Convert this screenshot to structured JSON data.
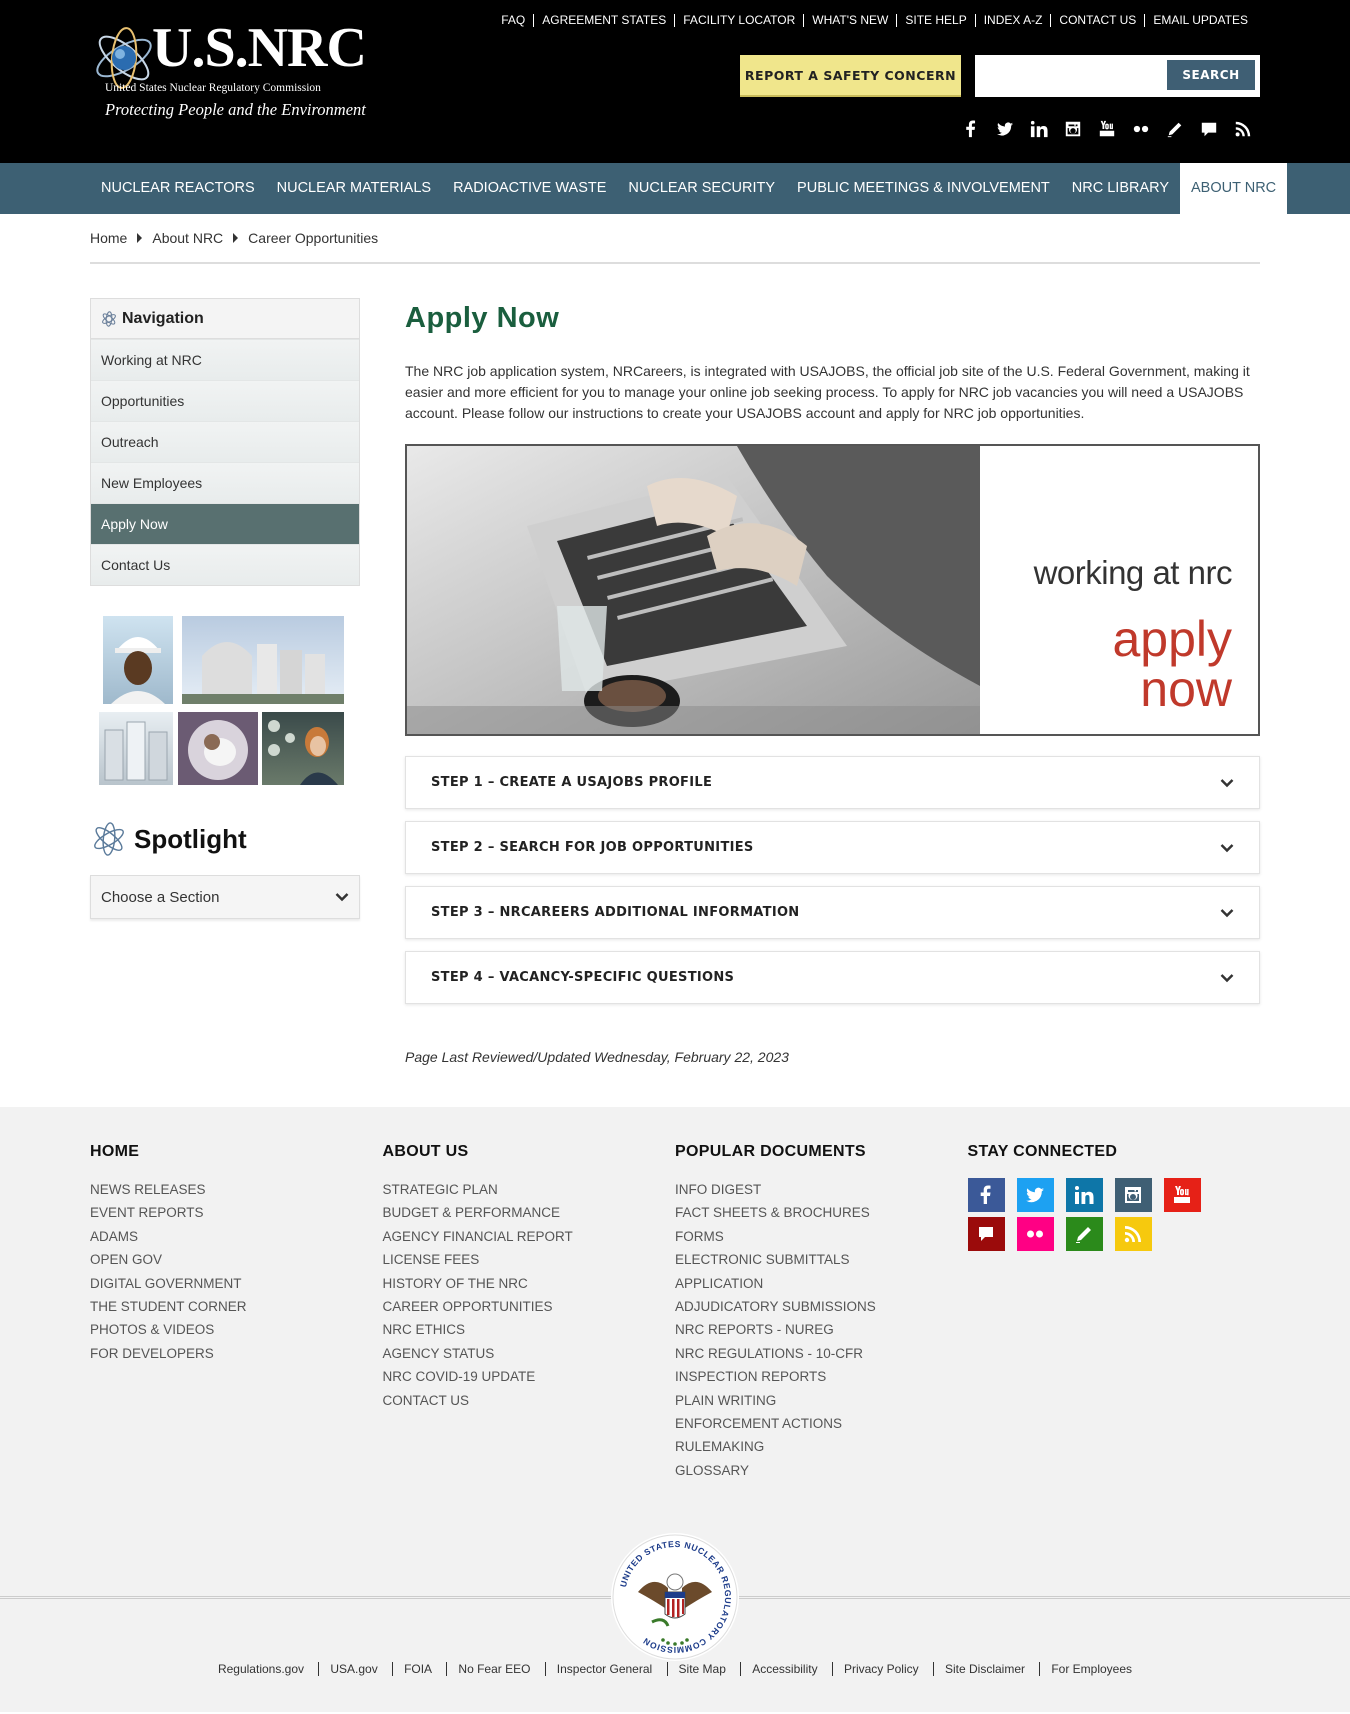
{
  "header": {
    "logo_title": "U.S.NRC",
    "logo_subtitle": "United States Nuclear Regulatory Commission",
    "logo_tagline": "Protecting People and the Environment",
    "utility_links": [
      "FAQ",
      "AGREEMENT STATES",
      "FACILITY LOCATOR",
      "WHAT'S NEW",
      "SITE HELP",
      "INDEX A-Z",
      "CONTACT US",
      "EMAIL UPDATES"
    ],
    "report_button": "REPORT A SAFETY CONCERN",
    "search_button": "SEARCH",
    "search_value": "",
    "social_icons": [
      "facebook-icon",
      "twitter-icon",
      "linkedin-icon",
      "instagram-icon",
      "youtube-icon",
      "flickr-icon",
      "blog-icon",
      "comment-icon",
      "rss-icon"
    ]
  },
  "mainnav": {
    "items": [
      "NUCLEAR REACTORS",
      "NUCLEAR MATERIALS",
      "RADIOACTIVE WASTE",
      "NUCLEAR SECURITY",
      "PUBLIC MEETINGS & INVOLVEMENT",
      "NRC LIBRARY",
      "ABOUT NRC"
    ],
    "active": "ABOUT NRC"
  },
  "breadcrumb": [
    "Home",
    "About NRC",
    "Career Opportunities"
  ],
  "sidebar": {
    "nav_title": "Navigation",
    "items": [
      "Working at NRC",
      "Opportunities",
      "Outreach",
      "New Employees",
      "Apply Now",
      "Contact Us"
    ],
    "active": "Apply Now",
    "spotlight_title": "Spotlight",
    "section_select": "Choose a Section"
  },
  "main": {
    "title": "Apply Now",
    "intro": "The NRC job application system, NRCareers, is integrated with USAJOBS, the official job site of the U.S. Federal Government, making it easier and more efficient for you to manage your online job seeking process. To apply for NRC job vacancies you will need a USAJOBS account. Please follow our instructions to create your USAJOBS account and apply for NRC job opportunities.",
    "banner_line1": "working at nrc",
    "banner_line2a": "apply",
    "banner_line2b": "now",
    "steps": [
      "STEP 1 – CREATE A USAJOBS PROFILE",
      "STEP 2 – SEARCH FOR JOB OPPORTUNITIES",
      "STEP 3 – NRCAREERS ADDITIONAL INFORMATION",
      "STEP 4 – VACANCY-SPECIFIC QUESTIONS"
    ],
    "reviewed": "Page Last Reviewed/Updated Wednesday, February 22, 2023"
  },
  "footer": {
    "home": {
      "title": "HOME",
      "links": [
        "NEWS RELEASES",
        "EVENT REPORTS",
        "ADAMS",
        "OPEN GOV",
        "DIGITAL GOVERNMENT",
        "THE STUDENT CORNER",
        "PHOTOS & VIDEOS",
        "FOR DEVELOPERS"
      ]
    },
    "about": {
      "title": "ABOUT US",
      "links": [
        "STRATEGIC PLAN",
        "BUDGET & PERFORMANCE",
        "AGENCY FINANCIAL REPORT",
        "LICENSE FEES",
        "HISTORY OF THE NRC",
        "CAREER OPPORTUNITIES",
        "NRC ETHICS",
        "AGENCY STATUS",
        "NRC COVID-19 UPDATE",
        "CONTACT US"
      ]
    },
    "docs": {
      "title": "POPULAR DOCUMENTS",
      "links": [
        "INFO DIGEST",
        "FACT SHEETS & BROCHURES",
        "FORMS",
        "ELECTRONIC SUBMITTALS",
        "APPLICATION",
        "ADJUDICATORY SUBMISSIONS",
        "NRC REPORTS - NUREG",
        "NRC REGULATIONS - 10-CFR",
        "INSPECTION REPORTS",
        "PLAIN WRITING",
        "ENFORCEMENT ACTIONS",
        "RULEMAKING",
        "GLOSSARY"
      ]
    },
    "connect": {
      "title": "STAY CONNECTED",
      "icons": [
        {
          "name": "facebook-icon",
          "color": "#3b5998"
        },
        {
          "name": "twitter-icon",
          "color": "#1da1f2"
        },
        {
          "name": "linkedin-icon",
          "color": "#0e76a8"
        },
        {
          "name": "instagram-icon",
          "color": "#3f5f74"
        },
        {
          "name": "youtube-icon",
          "color": "#e62117"
        },
        {
          "name": "comment-icon",
          "color": "#9b0b0b"
        },
        {
          "name": "flickr-icon",
          "color": "#ff0084"
        },
        {
          "name": "blog-icon",
          "color": "#2b8a1b"
        },
        {
          "name": "rss-icon",
          "color": "#f6c90e"
        }
      ]
    },
    "seal_text": "UNITED STATES NUCLEAR REGULATORY COMMISSION",
    "bottom_links": [
      "Regulations.gov",
      "USA.gov",
      "FOIA",
      "No Fear EEO",
      "Inspector General",
      "Site Map",
      "Accessibility",
      "Privacy Policy",
      "Site Disclaimer",
      "For Employees"
    ]
  }
}
